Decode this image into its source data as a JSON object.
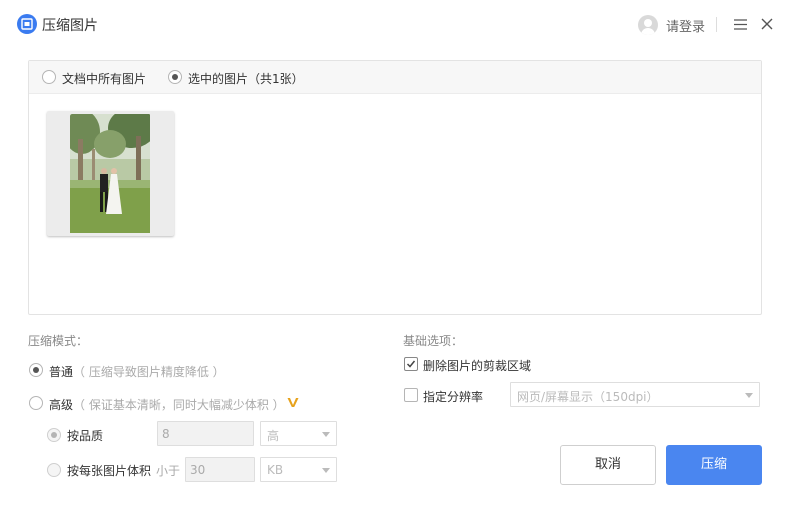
{
  "window": {
    "title": "压缩图片",
    "login_label": "请登录"
  },
  "scope": {
    "options": [
      {
        "label": "文档中所有图片",
        "selected": false
      },
      {
        "label": "选中的图片（共1张）",
        "selected": true
      }
    ]
  },
  "images": [
    {
      "description_icon": "wedding-photo-thumbnail"
    }
  ],
  "compress_mode": {
    "title": "压缩模式：",
    "normal": {
      "label": "普通",
      "hint": "（ 压缩导致图片精度降低 ）",
      "selected": true
    },
    "advanced": {
      "label": "高级",
      "hint": "（ 保证基本清晰，同时大幅减少体积 ）",
      "selected": false
    },
    "by_quality": {
      "label": "按品质",
      "value": "8",
      "unit": "高",
      "selected": true
    },
    "by_size": {
      "label": "按每张图片体积",
      "prefix": "小于",
      "value": "30",
      "unit": "KB",
      "selected": false
    }
  },
  "basic_options": {
    "title": "基础选项：",
    "delete_crop": {
      "label": "删除图片的剪裁区域",
      "checked": true
    },
    "resolution": {
      "label": "指定分辨率",
      "checked": false,
      "value": "网页/屏幕显示（150dpi）"
    }
  },
  "buttons": {
    "cancel": "取消",
    "confirm": "压缩"
  },
  "colors": {
    "accent": "#4a86f0",
    "vip": "#e7a21c"
  }
}
